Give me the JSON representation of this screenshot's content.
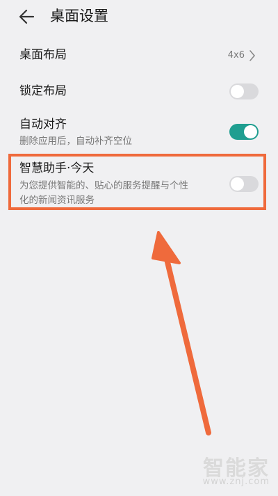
{
  "header": {
    "title": "桌面设置"
  },
  "settings": {
    "layout": {
      "label": "桌面布局",
      "value": "4x6"
    },
    "lock_layout": {
      "label": "锁定布局",
      "enabled": false
    },
    "auto_align": {
      "label": "自动对齐",
      "description": "删除应用后，自动补齐空位",
      "enabled": true
    },
    "smart_assistant": {
      "label": "智慧助手·今天",
      "description_line1": "为您提供智能的、贴心的服务提醒与个性",
      "description_line2": "化的新闻资讯服务",
      "enabled": false
    }
  },
  "watermark": {
    "brand": "智能家",
    "url": "www.znj.com"
  },
  "colors": {
    "accent": "#1f9e90",
    "highlight": "#ef6a3c"
  }
}
